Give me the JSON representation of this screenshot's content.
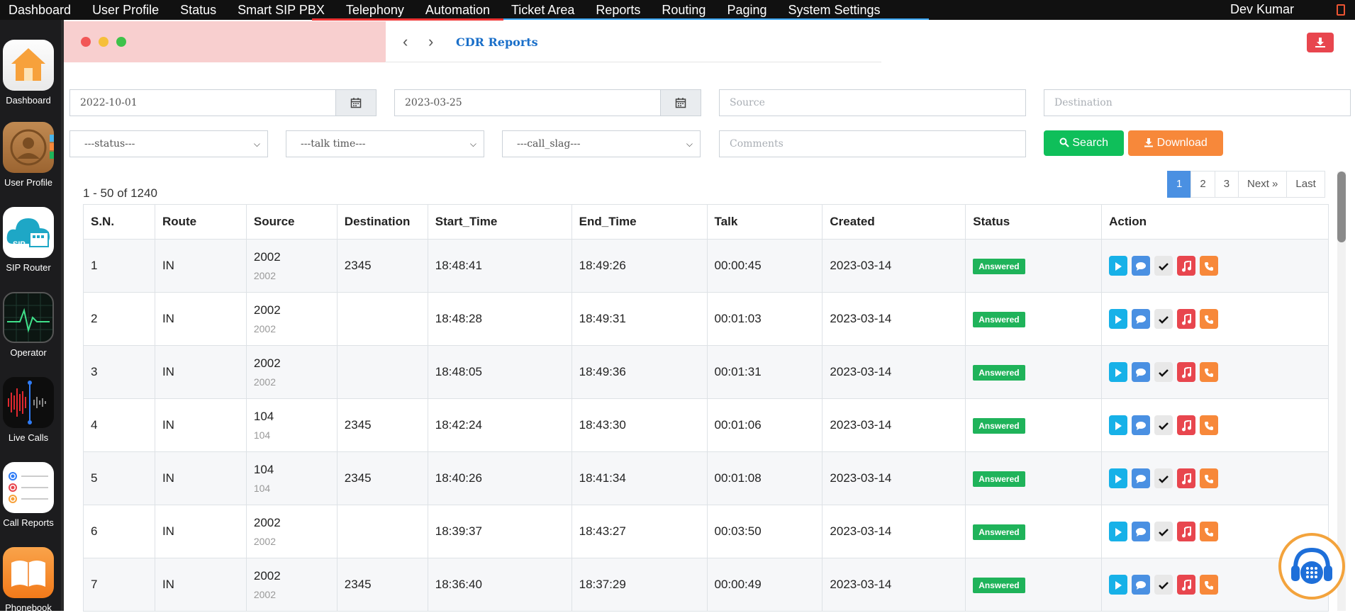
{
  "topbar": {
    "menu": [
      "Dashboard",
      "User Profile",
      "Status",
      "Smart SIP PBX",
      "Telephony",
      "Automation",
      "Ticket Area",
      "Reports",
      "Routing",
      "Paging",
      "System Settings"
    ],
    "user": "Dev Kumar"
  },
  "dock": {
    "items": [
      {
        "label": "Dashboard",
        "icon": "home-icon"
      },
      {
        "label": "User Profile",
        "icon": "user-profile-icon"
      },
      {
        "label": "SIP Router",
        "icon": "sip-cloud-icon",
        "badge": "SIP"
      },
      {
        "label": "Operator",
        "icon": "heartbeat-monitor-icon"
      },
      {
        "label": "Live Calls",
        "icon": "sound-wave-icon"
      },
      {
        "label": "Call Reports",
        "icon": "list-report-icon"
      },
      {
        "label": "Phonebook",
        "icon": "book-icon"
      }
    ]
  },
  "header": {
    "title": "CDR Reports"
  },
  "filters": {
    "date_from": "2022-10-01",
    "date_to": "2023-03-25",
    "source_placeholder": "Source",
    "destination_placeholder": "Destination",
    "status_select": "---status---",
    "talk_time_select": "---talk time---",
    "call_slag_select": "---call_slag---",
    "comments_placeholder": "Comments",
    "search_label": "Search",
    "download_label": "Download"
  },
  "results": {
    "count_text": "1 - 50 of 1240"
  },
  "pagination": [
    "1",
    "2",
    "3",
    "Next »",
    "Last"
  ],
  "table": {
    "headers": [
      "S.N.",
      "Route",
      "Source",
      "Destination",
      "Start_Time",
      "End_Time",
      "Talk",
      "Created",
      "Status",
      "Action"
    ],
    "rows": [
      {
        "sn": "1",
        "route": "IN",
        "source": "2002",
        "source_sub": "2002",
        "destination": "2345",
        "start": "18:48:41",
        "end": "18:49:26",
        "talk": "00:00:45",
        "created": "2023-03-14",
        "status": "Answered"
      },
      {
        "sn": "2",
        "route": "IN",
        "source": "2002",
        "source_sub": "2002",
        "destination": "",
        "start": "18:48:28",
        "end": "18:49:31",
        "talk": "00:01:03",
        "created": "2023-03-14",
        "status": "Answered"
      },
      {
        "sn": "3",
        "route": "IN",
        "source": "2002",
        "source_sub": "2002",
        "destination": "",
        "start": "18:48:05",
        "end": "18:49:36",
        "talk": "00:01:31",
        "created": "2023-03-14",
        "status": "Answered"
      },
      {
        "sn": "4",
        "route": "IN",
        "source": "104",
        "source_sub": "104",
        "destination": "2345",
        "start": "18:42:24",
        "end": "18:43:30",
        "talk": "00:01:06",
        "created": "2023-03-14",
        "status": "Answered"
      },
      {
        "sn": "5",
        "route": "IN",
        "source": "104",
        "source_sub": "104",
        "destination": "2345",
        "start": "18:40:26",
        "end": "18:41:34",
        "talk": "00:01:08",
        "created": "2023-03-14",
        "status": "Answered"
      },
      {
        "sn": "6",
        "route": "IN",
        "source": "2002",
        "source_sub": "2002",
        "destination": "",
        "start": "18:39:37",
        "end": "18:43:27",
        "talk": "00:03:50",
        "created": "2023-03-14",
        "status": "Answered"
      },
      {
        "sn": "7",
        "route": "IN",
        "source": "2002",
        "source_sub": "2002",
        "destination": "2345",
        "start": "18:36:40",
        "end": "18:37:29",
        "talk": "00:00:49",
        "created": "2023-03-14",
        "status": "Answered"
      }
    ]
  },
  "colors": {
    "accent_blue": "#1a6fc9",
    "answered_green": "#1fb35a",
    "search_green": "#0fbf5a",
    "download_orange": "#f7883a",
    "danger_red": "#e8464e"
  }
}
